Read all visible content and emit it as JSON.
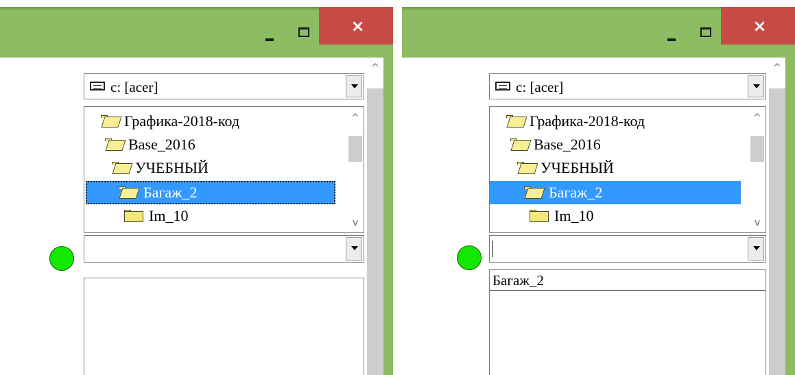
{
  "panels": [
    {
      "drive_combo": {
        "value": "c: [acer]"
      },
      "tree": {
        "items": [
          {
            "label": "Графика-2018-код"
          },
          {
            "label": "Base_2016"
          },
          {
            "label": "УЧЕБНЫЙ"
          },
          {
            "label": "Багаж_2"
          },
          {
            "label": "Im_10"
          }
        ],
        "selected": "Багаж_2"
      },
      "status_indicator": {
        "color": "#13e800"
      },
      "name_combo": {
        "value": ""
      },
      "file_list": {
        "items": []
      }
    },
    {
      "drive_combo": {
        "value": "c: [acer]"
      },
      "tree": {
        "items": [
          {
            "label": "Графика-2018-код"
          },
          {
            "label": "Base_2016"
          },
          {
            "label": "УЧЕБНЫЙ"
          },
          {
            "label": "Багаж_2"
          },
          {
            "label": "Im_10"
          }
        ],
        "selected": "Багаж_2"
      },
      "status_indicator": {
        "color": "#13e800"
      },
      "name_combo": {
        "value": ""
      },
      "file_list": {
        "items": [
          {
            "label": "Багаж_2"
          }
        ]
      }
    }
  ],
  "window_controls": {
    "minimize_icon": "minimize-icon",
    "maximize_icon": "maximize-icon",
    "close_icon": "close-icon",
    "close_glyph": "×"
  },
  "colors": {
    "title_bar": "#8dbc63",
    "close_button": "#c74a45",
    "selection": "#3399ff",
    "folder": "#f4e77a"
  }
}
